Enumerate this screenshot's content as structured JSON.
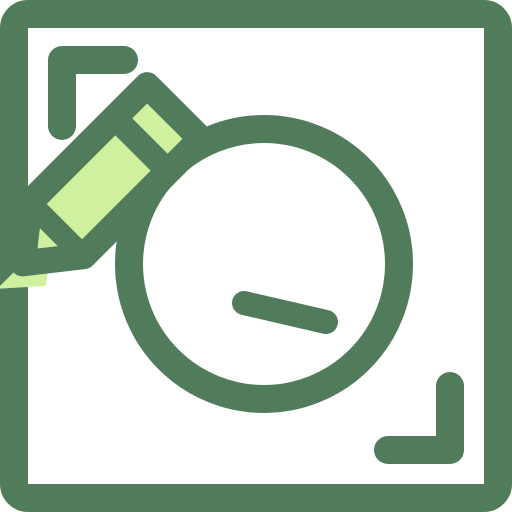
{
  "icon": {
    "name": "drawing-pencil-frame-icon",
    "colors": {
      "stroke": "#507C5C",
      "pencil_fill": "#CFF09E",
      "background": "#FFFFFF"
    }
  }
}
